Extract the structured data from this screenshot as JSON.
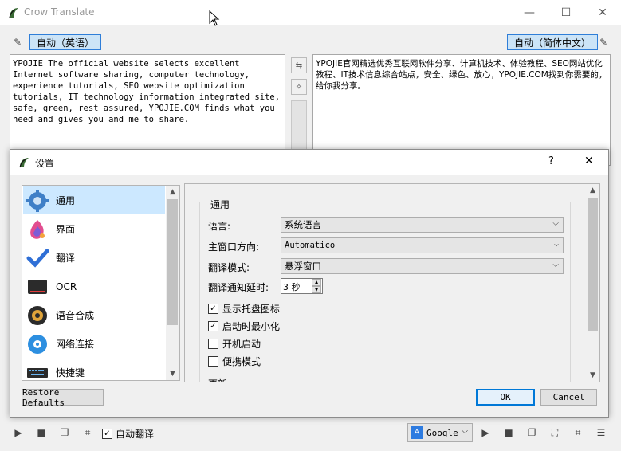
{
  "window": {
    "title": "Crow Translate",
    "minimize": "—",
    "maximize": "☐",
    "close": "✕"
  },
  "source": {
    "lang_button": "自动（英语）",
    "text": "YPOJIE The official website selects excellent Internet software sharing, computer technology, experience tutorials, SEO website optimization tutorials, IT technology information integrated site, safe, green, rest assured, YPOJIE.COM finds what you need and gives you and me to share."
  },
  "target": {
    "lang_button": "自动（简体中文）",
    "text": "YPOJIE官网精选优秀互联网软件分享、计算机技术、体验教程、SEO网站优化教程、IT技术信息综合站点，安全、绿色、放心，YPOJIE.COM找到你需要的，给你我分享。"
  },
  "dialog": {
    "title": "设置",
    "help": "?",
    "close": "✕",
    "nav": [
      {
        "label": "通用"
      },
      {
        "label": "界面"
      },
      {
        "label": "翻译"
      },
      {
        "label": "OCR"
      },
      {
        "label": "语音合成"
      },
      {
        "label": "网络连接"
      },
      {
        "label": "快捷键"
      }
    ],
    "general": {
      "group_title": "通用",
      "language_label": "语言:",
      "language_value": "系统语言",
      "orientation_label": "主窗口方向:",
      "orientation_value": "Automatico",
      "mode_label": "翻译模式:",
      "mode_value": "悬浮窗口",
      "delay_label": "翻译通知延时:",
      "delay_value": "3 秒",
      "chk_tray": "显示托盘图标",
      "chk_minimized": "启动时最小化",
      "chk_autostart": "开机启动",
      "chk_portable": "便携模式",
      "next_group_partial": "更新"
    },
    "restore_defaults": "Restore Defaults",
    "ok": "OK",
    "cancel": "Cancel"
  },
  "bottom": {
    "auto_translate": "自动翻译",
    "engine": "Google"
  }
}
